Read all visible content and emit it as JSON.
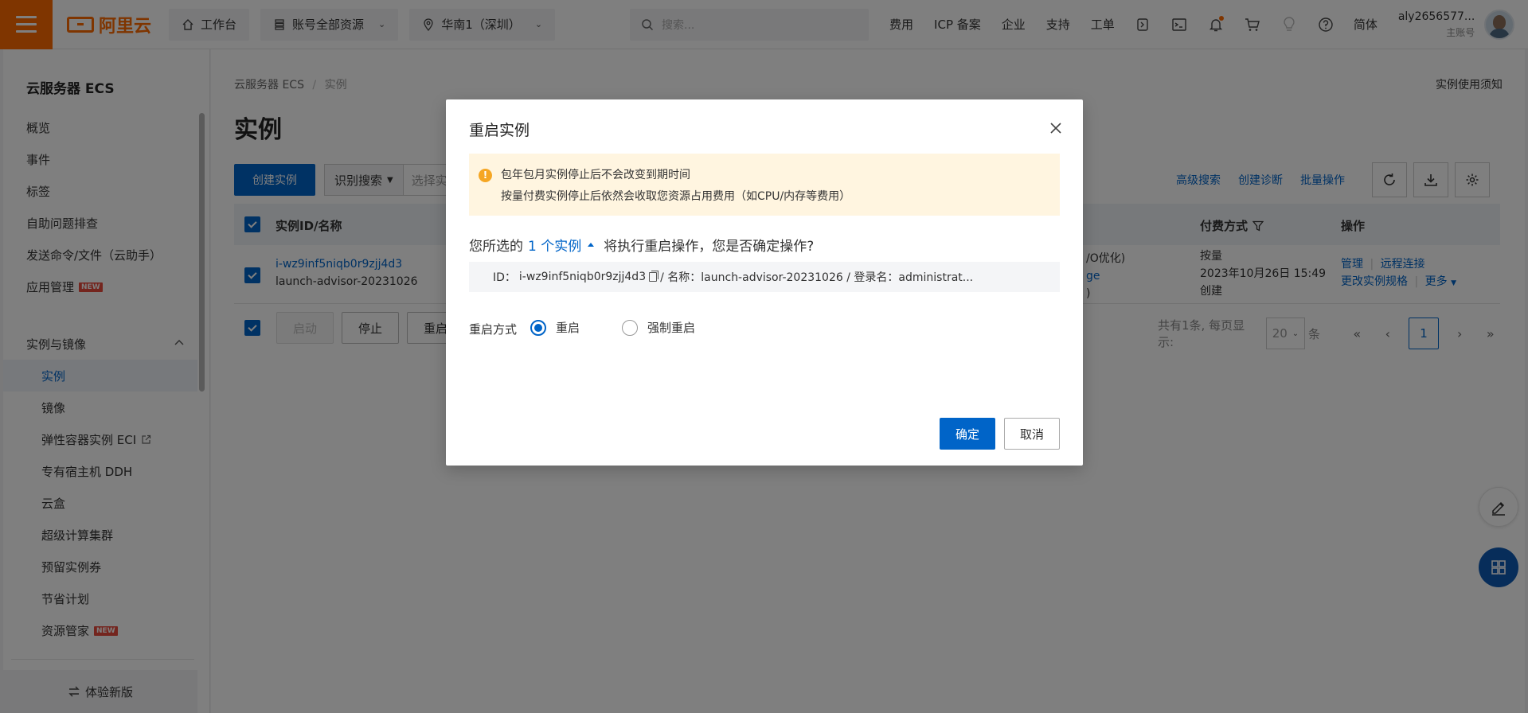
{
  "topbar": {
    "logo_text": "阿里云",
    "workbench": "工作台",
    "resources": "账号全部资源",
    "region": "华南1（深圳）",
    "search_placeholder": "搜索...",
    "links": [
      "费用",
      "ICP 备案",
      "企业",
      "支持",
      "工单"
    ],
    "language": "简体",
    "account_name": "aly2656577...",
    "account_type": "主账号",
    "brand_color": "#ff6a00"
  },
  "sidebar": {
    "title": "云服务器 ECS",
    "items": [
      "概览",
      "事件",
      "标签",
      "自助问题排查",
      "发送命令/文件（云助手）",
      "应用管理"
    ],
    "new_badge": "NEW",
    "group_title": "实例与镜像",
    "group_items": [
      "实例",
      "镜像",
      "弹性容器实例 ECI",
      "专有宿主机 DDH",
      "云盒",
      "超级计算集群",
      "预留实例券",
      "节省计划",
      "资源管家"
    ],
    "footer": "体验新版"
  },
  "main": {
    "breadcrumb_root": "云服务器 ECS",
    "breadcrumb_sep": "/",
    "breadcrumb_current": "实例",
    "title": "实例",
    "notice_link": "实例使用须知",
    "create_button": "创建实例",
    "search_select": "识别搜索",
    "search_placeholder": "选择实例",
    "toolbar_links": [
      "高级搜索",
      "创建诊断",
      "批量操作"
    ],
    "columns": {
      "id_name": "实例ID/名称",
      "billing": "付费方式",
      "actions": "操作"
    },
    "row": {
      "instance_id": "i-wz9inf5niqb0r9zjj4d3",
      "instance_name": "launch-advisor-20231026",
      "partial_1": "/O优化)",
      "partial_2": "ge",
      "partial_3": ")",
      "billing_type": "按量",
      "created_time": "2023年10月26日 15:49",
      "created_label": "创建",
      "action_manage": "管理",
      "action_remote": "远程连接",
      "action_resize": "更改实例规格",
      "action_more": "更多"
    },
    "footer_buttons": [
      "启动",
      "停止",
      "重启"
    ],
    "pager_text": "共有1条, 每页显示:",
    "page_size": "20",
    "page_size_unit": "条",
    "current_page": "1"
  },
  "modal": {
    "title": "重启实例",
    "warning_line1": "包年包月实例停止后不会改变到期时间",
    "warning_line2": "按量付费实例停止后依然会收取您资源占用费用（如CPU/内存等费用）",
    "question_prefix": "您所选的",
    "selected_count": "1 个实例",
    "question_suffix": "将执行重启操作，您是否确定操作?",
    "id_label": "ID：",
    "id_value": "i-wz9inf5niqb0r9zjj4d3",
    "name_part": "/ 名称：launch-advisor-20231026 / 登录名：administrat...",
    "mode_label": "重启方式",
    "option_restart": "重启",
    "option_force": "强制重启",
    "ok_button": "确定",
    "cancel_button": "取消"
  }
}
